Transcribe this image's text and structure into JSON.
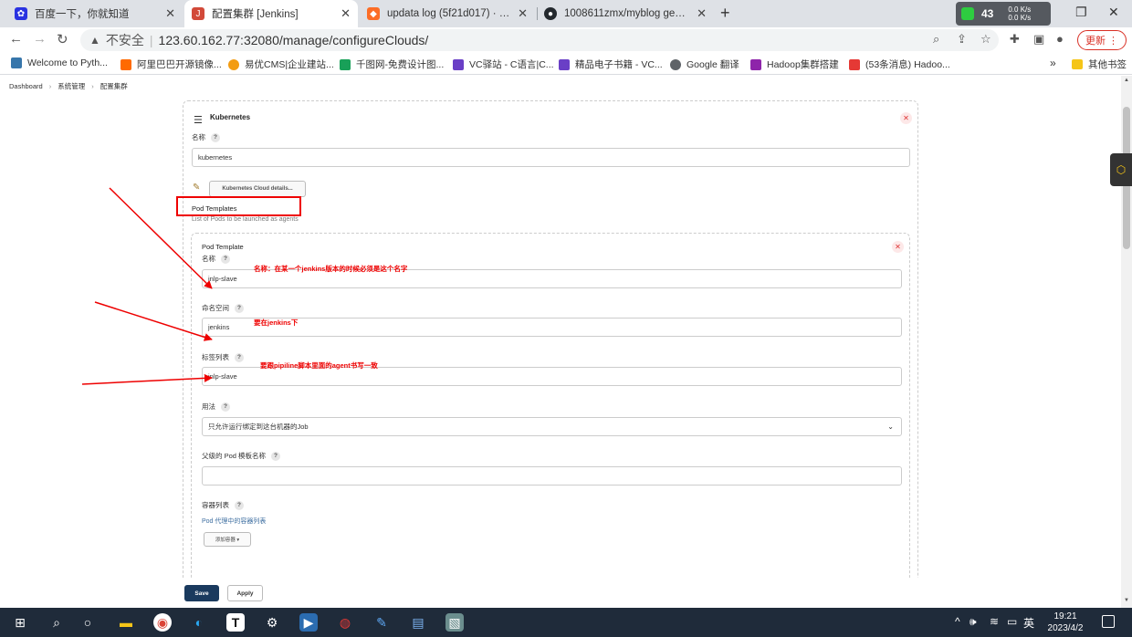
{
  "browser": {
    "tabs": [
      {
        "title": "百度一下，你就知道",
        "active": false
      },
      {
        "title": "配置集群 [Jenkins]",
        "active": true
      },
      {
        "title": "updata log (5f21d017) · Comm",
        "active": false
      },
      {
        "title": "1008611zmx/myblog general",
        "active": false
      }
    ],
    "new_tab": "+",
    "net_widget": {
      "percent": "43",
      "up": "0.0 K/s",
      "down": "0.0 K/s"
    },
    "address": {
      "warning": "不安全",
      "url": "123.60.162.77:32080/manage/configureClouds/"
    },
    "update_label": "更新 ⋮",
    "bookmarks": [
      {
        "label": "Welcome to Pyth...",
        "color": "#3776ab"
      },
      {
        "label": "阿里巴巴开源镜像...",
        "color": "#ff6a00"
      },
      {
        "label": "易优CMS|企业建站...",
        "color": "#f39c12"
      },
      {
        "label": "千图网-免费设计图...",
        "color": "#18a058"
      },
      {
        "label": "VC驿站 - C语言|C...",
        "color": "#6a3fc6"
      },
      {
        "label": "精品电子书籍 - VC...",
        "color": "#6a3fc6"
      },
      {
        "label": "Google 翻译",
        "color": "#5f6368"
      },
      {
        "label": "Hadoop集群搭建",
        "color": "#8e24aa"
      },
      {
        "label": "(53条消息) Hadoo...",
        "color": "#e53935"
      }
    ],
    "bookmarks_more": "»",
    "other_bookmarks": "其他书签"
  },
  "breadcrumb": [
    "Dashboard",
    "系统管理",
    "配置集群"
  ],
  "cloud": {
    "title": "Kubernetes",
    "name_label": "名称",
    "name_value": "kubernetes",
    "details_button": "Kubernetes Cloud details...",
    "pod_templates_label": "Pod Templates",
    "pod_templates_desc": "List of Pods to be launched as agents"
  },
  "pod_template": {
    "heading": "Pod Template",
    "name_label": "名称",
    "name_value": "jnlp-slave",
    "namespace_label": "命名空间",
    "namespace_value": "jenkins",
    "labels_label": "标签列表",
    "labels_value": "jnlp-slave",
    "usage_label": "用法",
    "usage_value": "只允许运行绑定到这台机器的Job",
    "parent_label": "父级的 Pod 模板名称",
    "parent_value": "",
    "containers_label": "容器列表",
    "containers_desc": "Pod 代理中的容器列表",
    "add_container": "添加容器 ▾"
  },
  "annotations": {
    "name_note": "名称：在某一个jenkins版本的时候必须是这个名字",
    "namespace_note": "要在jenkins下",
    "labels_note": "要跟pipiline脚本里面的agent书写一致"
  },
  "actions": {
    "save": "Save",
    "apply": "Apply"
  },
  "taskbar": {
    "ime": "英",
    "time": "19:21",
    "date": "2023/4/2"
  }
}
